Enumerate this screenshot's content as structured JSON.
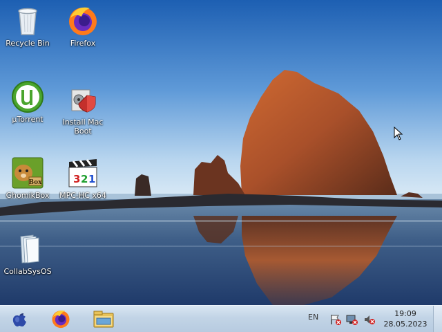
{
  "desktop": {
    "icons": [
      {
        "name": "recycle-bin",
        "label": "Recycle Bin"
      },
      {
        "name": "firefox",
        "label": "Firefox"
      },
      {
        "name": "utorrent",
        "label": "µTorrent"
      },
      {
        "name": "install-mac-boot",
        "label": "Install Mac Boot"
      },
      {
        "name": "ghomikbox",
        "label": "GhomikBox"
      },
      {
        "name": "mpc-hc",
        "label": "MPC-HC x64"
      },
      {
        "name": "collabsysos",
        "label": "CollabSysOS"
      }
    ]
  },
  "taskbar": {
    "start_icon": "apple-icon",
    "pinned": [
      "firefox-icon",
      "file-explorer-icon"
    ],
    "tray": {
      "language": "EN",
      "icons": [
        "action-center-flag-icon",
        "network-disconnected-icon",
        "volume-muted-icon"
      ],
      "time": "19:09",
      "date": "28.05.2023"
    }
  },
  "colors": {
    "sky_top": "#1f63b5",
    "sky_bottom": "#cfe4f4",
    "rock": "#b2552a",
    "taskbar": "#c8d8ea"
  }
}
